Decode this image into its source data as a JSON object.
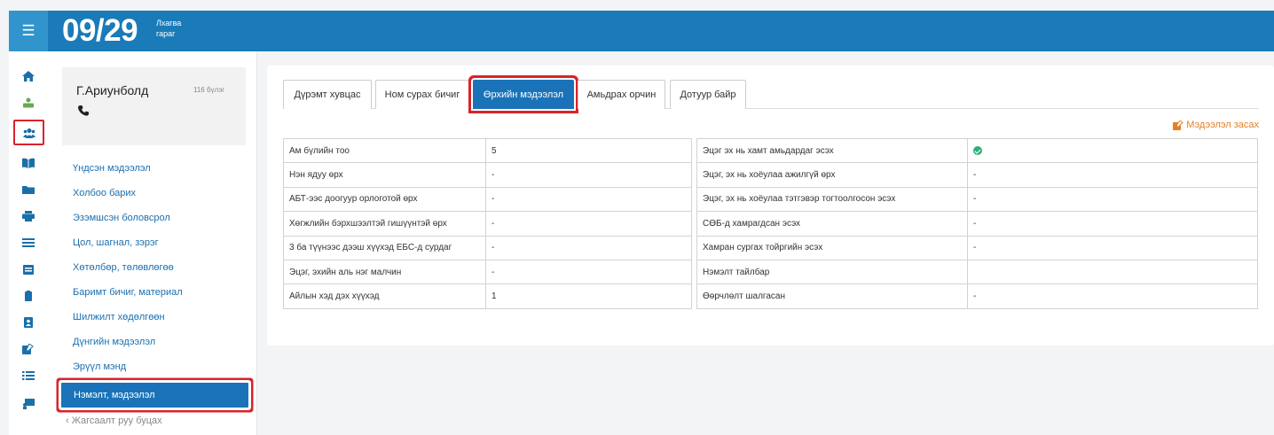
{
  "header": {
    "date": "09/29",
    "weekday_line1": "Лхагва",
    "weekday_line2": "гараг"
  },
  "icon_sidebar": {
    "items": [
      {
        "icon": "home-icon"
      },
      {
        "icon": "hand-coins-icon"
      },
      {
        "icon": "users-icon",
        "highlighted": true
      },
      {
        "icon": "book-open-icon"
      },
      {
        "icon": "folder-icon"
      },
      {
        "icon": "print-icon"
      },
      {
        "icon": "list-icon"
      },
      {
        "icon": "calendar-icon"
      },
      {
        "icon": "clipboard-icon"
      },
      {
        "icon": "address-book-icon"
      },
      {
        "icon": "edit-icon"
      },
      {
        "icon": "task-list-icon"
      },
      {
        "icon": "teacher-board-icon"
      }
    ]
  },
  "profile": {
    "name": "Г.Ариунболд",
    "code": "116 бүлэг"
  },
  "nav": {
    "items": [
      {
        "label": "Үндсэн мэдээлэл"
      },
      {
        "label": "Холбоо барих"
      },
      {
        "label": "Эзэмшсэн боловсрол"
      },
      {
        "label": "Цол, шагнал, зэрэг"
      },
      {
        "label": "Хөтөлбөр, төлөвлөгөө"
      },
      {
        "label": "Баримт бичиг, материал"
      },
      {
        "label": "Шилжилт хөдөлгөөн"
      },
      {
        "label": "Дүнгийн мэдээлэл"
      },
      {
        "label": "Эрүүл мэнд"
      },
      {
        "label": "Нэмэлт, мэдээлэл",
        "active": true
      }
    ],
    "back_label": "Жагсаалт руу буцах"
  },
  "tabs": [
    {
      "label": "Дүрэмт хувцас"
    },
    {
      "label": "Ном сурах бичиг"
    },
    {
      "label": "Өрхийн мэдээлэл",
      "active": true
    },
    {
      "label": "Амьдрах орчин"
    },
    {
      "label": "Дотуур байр"
    }
  ],
  "edit_label": "Мэдээлэл засах",
  "left_table": [
    {
      "label": "Ам бүлийн тоо",
      "value": "5"
    },
    {
      "label": "Нэн ядуу өрх",
      "value": "-"
    },
    {
      "label": "АБТ-ээс доогуур орлоготой өрх",
      "value": "-"
    },
    {
      "label": "Хөгжлийн бэрхшээлтэй гишүүнтэй өрх",
      "value": "-"
    },
    {
      "label": "3 ба түүнээс дээш хүүхэд ЕБС-д сурдаг",
      "value": "-"
    },
    {
      "label": "Эцэг, эхийн аль нэг малчин",
      "value": "-"
    },
    {
      "label": "Айлын хэд дэх хүүхэд",
      "value": "1"
    }
  ],
  "right_table": [
    {
      "label": "Эцэг эх нь хамт амьдардаг эсэх",
      "value": "",
      "check": true
    },
    {
      "label": "Эцэг, эх нь хоёулаа ажилгүй өрх",
      "value": "-"
    },
    {
      "label": "Эцэг, эх нь хоёулаа тэтгэвэр тогтоолгосон эсэх",
      "value": "-"
    },
    {
      "label": "СӨБ-д хамрагдсан эсэх",
      "value": "-"
    },
    {
      "label": "Хамран сургах тойргийн эсэх",
      "value": "-"
    },
    {
      "label": "Нэмэлт тайлбар",
      "value": ""
    },
    {
      "label": "Өөрчлөлт шалгасан",
      "value": "-"
    }
  ],
  "colors": {
    "header": "#1a7bb8",
    "accent": "#1a73b8",
    "highlight_border": "#d9232a",
    "edit_link": "#e67e22",
    "check": "#2ab27b"
  }
}
